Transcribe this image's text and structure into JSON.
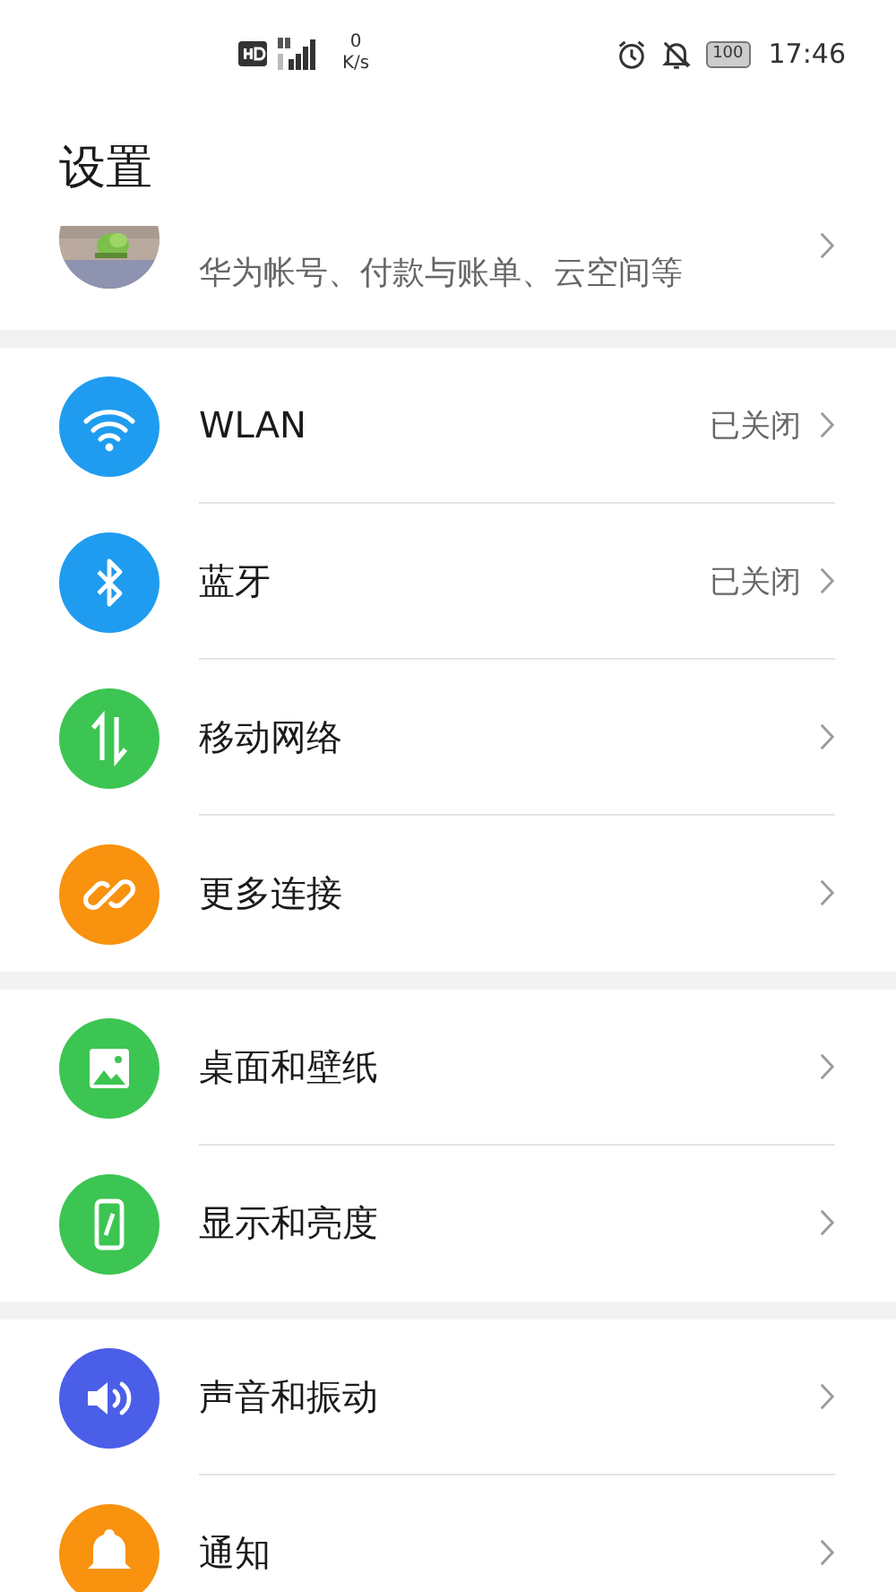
{
  "status_bar": {
    "net_speed_value": "0",
    "net_speed_unit": "K/s",
    "battery": "100",
    "time": "17:46"
  },
  "title": "设置",
  "account": {
    "subtitle": "华为帐号、付款与账单、云空间等"
  },
  "groups": [
    {
      "items": [
        {
          "kind": "wifi",
          "label": "WLAN",
          "status": "已关闭",
          "color": "#1f9cf0"
        },
        {
          "kind": "bluetooth",
          "label": "蓝牙",
          "status": "已关闭",
          "color": "#1f9cf0"
        },
        {
          "kind": "mobile-data",
          "label": "移动网络",
          "color": "#3cc552"
        },
        {
          "kind": "link",
          "label": "更多连接",
          "color": "#f8920f"
        }
      ]
    },
    {
      "items": [
        {
          "kind": "wallpaper",
          "label": "桌面和壁纸",
          "color": "#3cc552"
        },
        {
          "kind": "display",
          "label": "显示和亮度",
          "color": "#3cc552"
        }
      ]
    },
    {
      "items": [
        {
          "kind": "sound",
          "label": "声音和振动",
          "color": "#4a5ee8"
        },
        {
          "kind": "bell",
          "label": "通知",
          "color": "#f8920f"
        }
      ]
    }
  ]
}
